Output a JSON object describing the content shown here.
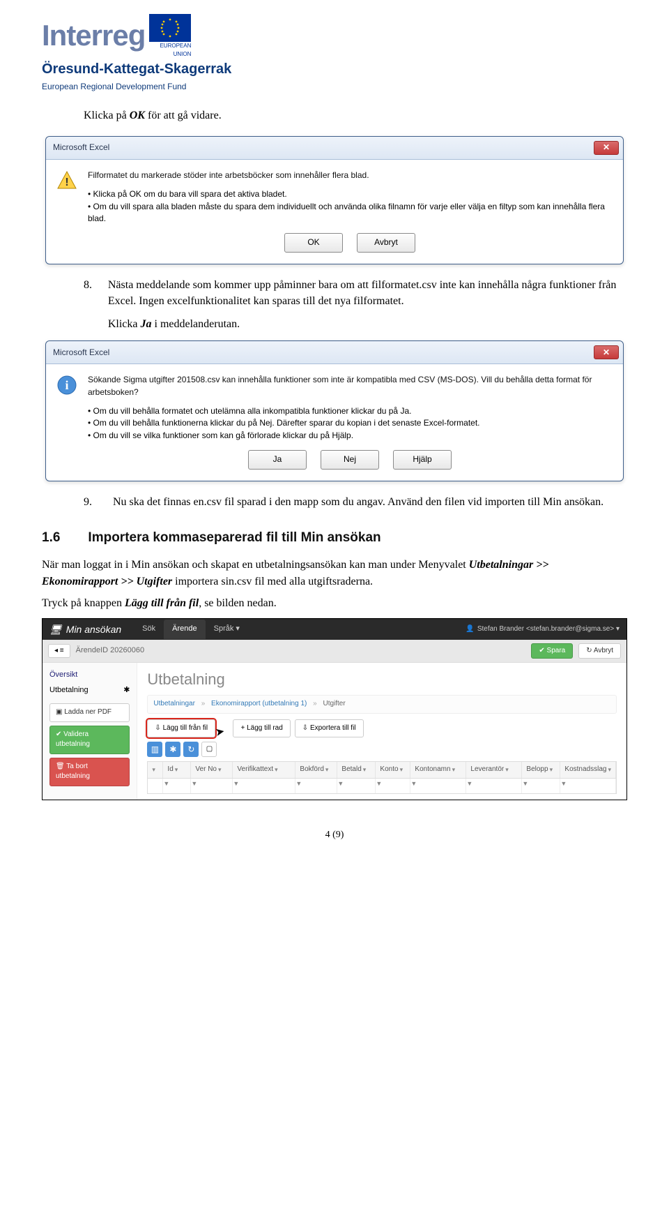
{
  "logo": {
    "wordmark": "Interreg",
    "eu_label": "EUROPEAN UNION",
    "sub1": "Öresund-Kattegat-Skagerrak",
    "sub2": "European Regional Development Fund"
  },
  "intro": {
    "line1_a": "Klicka på ",
    "line1_b": "OK",
    "line1_c": " för att gå vidare."
  },
  "dialog1": {
    "title": "Microsoft Excel",
    "msg": "Filformatet du markerade stöder inte arbetsböcker som innehåller flera blad.",
    "b1": "Klicka på OK om du bara vill spara det aktiva bladet.",
    "b2": "Om du vill spara alla bladen måste du spara dem individuellt och använda olika filnamn för varje eller välja en filtyp som kan innehålla flera blad.",
    "ok": "OK",
    "cancel": "Avbryt"
  },
  "step8": {
    "n": "8.",
    "text_a": "Nästa meddelande som kommer upp påminner bara om att filformatet.csv inte kan innehålla några funktioner från Excel. Ingen excelfunktionalitet kan sparas till det nya filformatet.",
    "text_b_a": "Klicka ",
    "text_b_b": "Ja",
    "text_b_c": " i meddelanderutan."
  },
  "dialog2": {
    "title": "Microsoft Excel",
    "msg": "Sökande Sigma utgifter 201508.csv kan innehålla funktioner som inte är kompatibla med CSV (MS-DOS). Vill du behålla detta format för arbetsboken?",
    "b1": "Om du vill behålla formatet och utelämna alla inkompatibla funktioner klickar du på Ja.",
    "b2": "Om du vill behålla funktionerna klickar du på Nej. Därefter sparar du kopian i det senaste Excel-formatet.",
    "b3": "Om du vill se vilka funktioner som kan gå förlorade klickar du på Hjälp.",
    "yes": "Ja",
    "no": "Nej",
    "help": "Hjälp"
  },
  "step9": {
    "n": "9.",
    "text": "Nu ska det finnas en.csv fil sparad i den mapp som du angav. Använd den filen vid importen till Min ansökan."
  },
  "h2": {
    "num": "1.6",
    "title": "Importera kommaseparerad fil till Min ansökan"
  },
  "para1_a": "När man loggat in i Min ansökan och skapat en utbetalningsansökan kan man under Menyvalet ",
  "para1_b": "Utbetalningar >> Ekonomirapport >> Utgifter",
  "para1_c": " importera sin.csv fil med alla utgiftsraderna.",
  "para2_a": "Tryck på knappen ",
  "para2_b": "Lägg till från fil",
  "para2_c": ", se bilden nedan.",
  "app": {
    "logo": "Min ansökan",
    "tab_sok": "Sök",
    "tab_arende": "Ärende",
    "tab_sprak": "Språk ▾",
    "user": "Stefan Brander <stefan.brander@sigma.se> ▾",
    "back": "◂ ≡",
    "arende": "ÄrendeID 20260060",
    "spara": "✔ Spara",
    "avbryt": "↻ Avbryt",
    "side_oversikt": "Översikt",
    "side_utbet": "Utbetalning",
    "side_star": "✱",
    "side_pdf": "▣ Ladda ner PDF",
    "side_validera": "✔ Validera utbetalning",
    "side_ta_bort": "🗑 Ta bort utbetalning",
    "main_title": "Utbetalning",
    "bc1": "Utbetalningar",
    "bc2": "Ekonomirapport (utbetalning 1)",
    "bc3": "Utgifter",
    "btn_fromfile": "⇩ Lägg till från fil",
    "btn_addrow": "+ Lägg till rad",
    "btn_export": "⇩ Exportera till fil",
    "col_id": "Id",
    "col_verno": "Ver No",
    "col_veriftext": "Verifikattext",
    "col_bokford": "Bokförd",
    "col_betald": "Betald",
    "col_konto": "Konto",
    "col_kontonamn": "Kontonamn",
    "col_leverantor": "Leverantör",
    "col_belopp": "Belopp",
    "col_kostnadsslag": "Kostnadsslag"
  },
  "pagenum": "4 (9)"
}
